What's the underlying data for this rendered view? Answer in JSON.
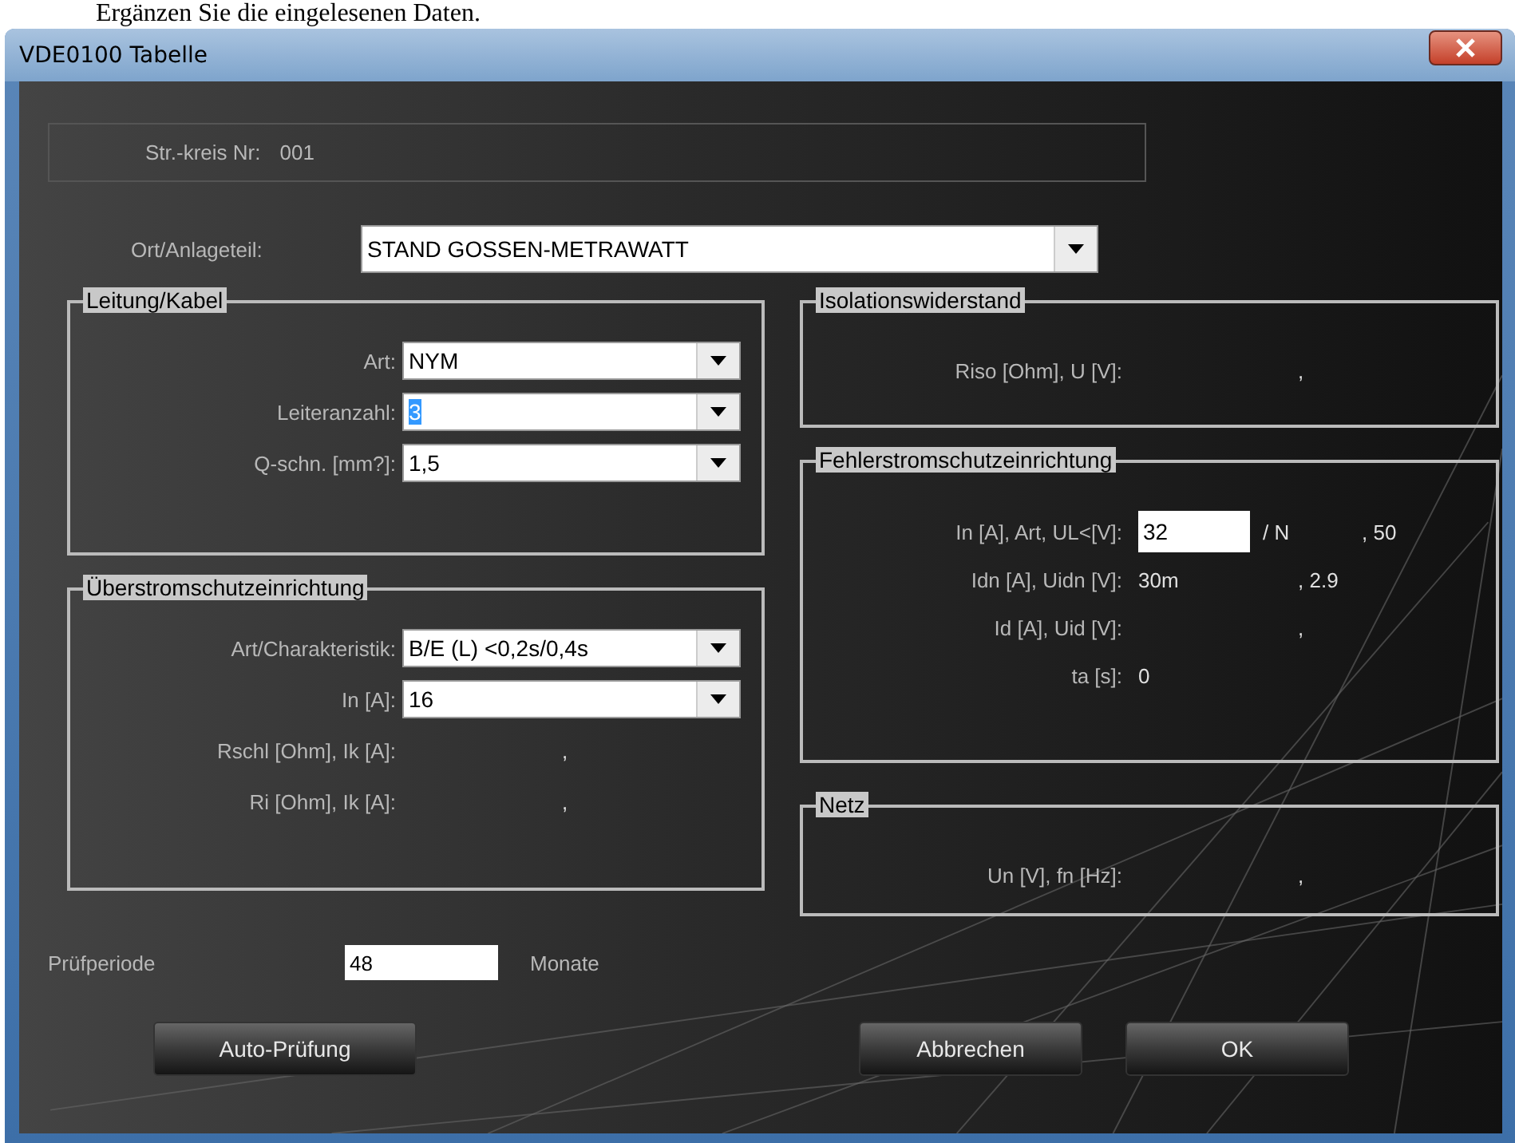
{
  "caption": "Ergänzen Sie die eingelesenen Daten.",
  "window": {
    "title": "VDE0100 Tabelle"
  },
  "circuit": {
    "label": "Str.-kreis Nr:",
    "value": "001"
  },
  "location": {
    "label": "Ort/Anlageteil:",
    "value": "STAND GOSSEN-METRAWATT"
  },
  "left_groups": [
    {
      "title": "Leitung/Kabel",
      "rows": [
        {
          "kind": "combo",
          "label": "Art:",
          "value": "NYM",
          "text_selected": false
        },
        {
          "kind": "combo",
          "label": "Leiteranzahl:",
          "value": "3",
          "text_selected": true
        },
        {
          "kind": "combo",
          "label": "Q-schn. [mm?]:",
          "value": "1,5",
          "text_selected": false
        }
      ]
    },
    {
      "title": "Überstromschutzeinrichtung",
      "rows": [
        {
          "kind": "combo",
          "label": "Art/Charakteristik:",
          "value": "B/E (L) <0,2s/0,4s",
          "text_selected": false
        },
        {
          "kind": "combo",
          "label": "In [A]:",
          "value": "16",
          "text_selected": false
        },
        {
          "kind": "reading",
          "label": "Rschl [Ohm], Ik [A]:",
          "second": ","
        },
        {
          "kind": "reading",
          "label": "Ri [Ohm], Ik [A]:",
          "second": ","
        }
      ]
    }
  ],
  "right_groups": [
    {
      "title": "Isolationswiderstand",
      "rows": [
        {
          "kind": "reading",
          "label": "Riso [Ohm], U [V]:",
          "second": ","
        }
      ]
    },
    {
      "title": "Fehlerstromschutzeinrichtung",
      "rows": [
        {
          "kind": "input",
          "label": "In [A], Art, UL<[V]:",
          "value": "32",
          "first": "/  N",
          "second": ",  50"
        },
        {
          "kind": "reading",
          "label": "Idn [A], Uidn [V]:",
          "first": "30m",
          "second": ",  2.9"
        },
        {
          "kind": "reading",
          "label": "Id [A], Uid [V]:",
          "second": ","
        },
        {
          "kind": "reading",
          "label": "ta [s]:",
          "first": "0"
        }
      ]
    },
    {
      "title": "Netz",
      "rows": [
        {
          "kind": "reading",
          "label": "Un [V], fn [Hz]:",
          "second": ","
        }
      ]
    }
  ],
  "period": {
    "label": "Prüfperiode",
    "value": "48",
    "unit": "Monate"
  },
  "buttons": [
    {
      "label": "Auto-Prüfung"
    },
    {
      "label": "Abbrechen"
    },
    {
      "label": "OK"
    }
  ]
}
